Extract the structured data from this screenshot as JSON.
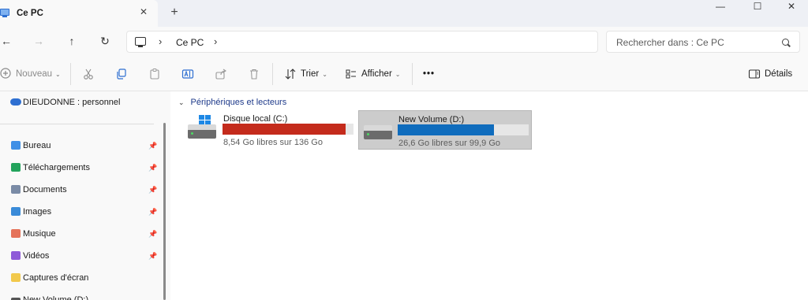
{
  "window": {
    "tab_title": "Ce PC",
    "tab_close": "✕",
    "new_tab": "+",
    "minimize": "—",
    "maximize": "☐",
    "close": "✕"
  },
  "nav": {
    "back": "←",
    "forward": "→",
    "up": "↑",
    "refresh": "↻"
  },
  "breadcrumb": {
    "sep": "›",
    "current": "Ce PC"
  },
  "search": {
    "placeholder": "Rechercher dans : Ce PC"
  },
  "toolbar": {
    "new_label": "Nouveau",
    "sort_label": "Trier",
    "view_label": "Afficher",
    "more_label": "•••",
    "details_label": "Détails"
  },
  "sidebar": {
    "cloud_label": "DIEUDONNE : personnel",
    "items": [
      {
        "label": "Bureau",
        "pinned": true,
        "color": "#3f8fe6"
      },
      {
        "label": "Téléchargements",
        "pinned": true,
        "color": "#23a35c"
      },
      {
        "label": "Documents",
        "pinned": true,
        "color": "#7a8ba6"
      },
      {
        "label": "Images",
        "pinned": true,
        "color": "#3a8bd8"
      },
      {
        "label": "Musique",
        "pinned": true,
        "color": "#e5735a"
      },
      {
        "label": "Vidéos",
        "pinned": true,
        "color": "#8e5ad8"
      },
      {
        "label": "Captures d'écran",
        "pinned": false,
        "color": "#f2c94c"
      },
      {
        "label": "New Volume (D:)",
        "pinned": false,
        "color": "#555555"
      }
    ]
  },
  "content": {
    "group_title": "Périphériques et lecteurs",
    "drives": [
      {
        "name": "Disque local (C:)",
        "info": "8,54 Go libres sur 136 Go",
        "used_fraction": 0.937,
        "bar_color": "#c42b1c"
      },
      {
        "name": "New Volume (D:)",
        "info": "26,6 Go libres sur 99,9 Go",
        "used_fraction": 0.734,
        "bar_color": "#0f6cbd"
      }
    ]
  }
}
